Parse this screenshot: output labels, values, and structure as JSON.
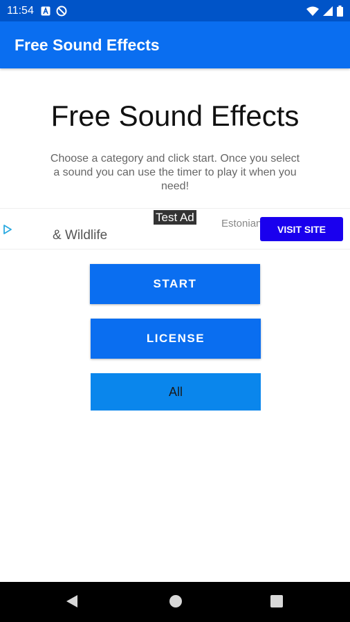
{
  "status_bar": {
    "time": "11:54",
    "icons": [
      "notification-a-icon",
      "dnd-icon",
      "wifi-icon",
      "cellular-signal-icon",
      "battery-icon"
    ]
  },
  "app_bar": {
    "title": "Free Sound Effects"
  },
  "main": {
    "heading": "Free Sound Effects",
    "description": "Choose a category and click start. Once you select a sound you can use the timer to play it when you need!"
  },
  "ad": {
    "label": "Test Ad",
    "headline": "& Wildlife",
    "body": "Estonian and plea",
    "cta": "VISIT SITE"
  },
  "buttons": {
    "start": "START",
    "license": "LICENSE",
    "category_selected": "All"
  },
  "colors": {
    "status_bar": "#0054c8",
    "primary": "#0a6ef0",
    "category": "#0a86ec",
    "ad_cta": "#1a00ee"
  },
  "nav": {
    "icons": [
      "back-icon",
      "home-icon",
      "recents-icon"
    ]
  }
}
